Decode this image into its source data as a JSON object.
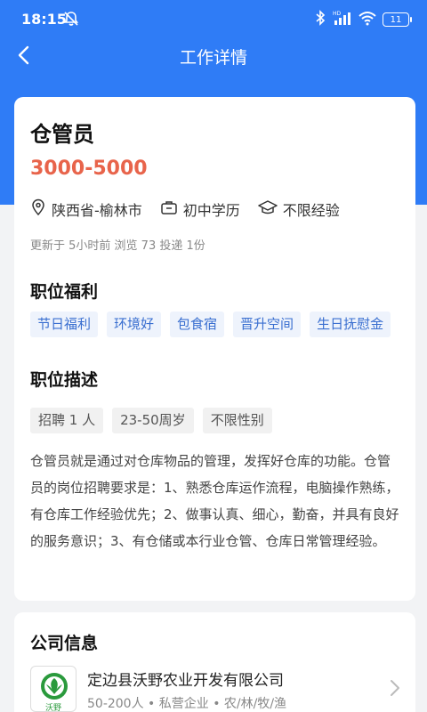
{
  "status": {
    "time": "18:15",
    "battery": "11",
    "hd": "HD"
  },
  "header": {
    "title": "工作详情"
  },
  "job": {
    "title": "仓管员",
    "salary": "3000-5000",
    "location": "陕西省-榆林市",
    "education": "初中学历",
    "experience": "不限经验",
    "updated": "更新于 5小时前  浏览 73  投递 1份"
  },
  "benefits": {
    "title": "职位福利",
    "tags": [
      "节日福利",
      "环境好",
      "包食宿",
      "晋升空间",
      "生日抚慰金"
    ]
  },
  "description": {
    "title": "职位描述",
    "tags": [
      "招聘 1 人",
      "23-50周岁",
      "不限性别"
    ],
    "text": "仓管员就是通过对仓库物品的管理，发挥好仓库的功能。仓管员的岗位招聘要求是：1、熟悉仓库运作流程，电脑操作熟练，有仓库工作经验优先；2、做事认真、细心，勤奋，并具有良好的服务意识；3、有仓储或本行业仓管、仓库日常管理经验。"
  },
  "company": {
    "section_title": "公司信息",
    "name": "定边县沃野农业开发有限公司",
    "meta": "50-200人  •  私营企业  •  农/林/牧/渔",
    "logo_text": "沃野",
    "logo_color": "#2a9a3c"
  }
}
